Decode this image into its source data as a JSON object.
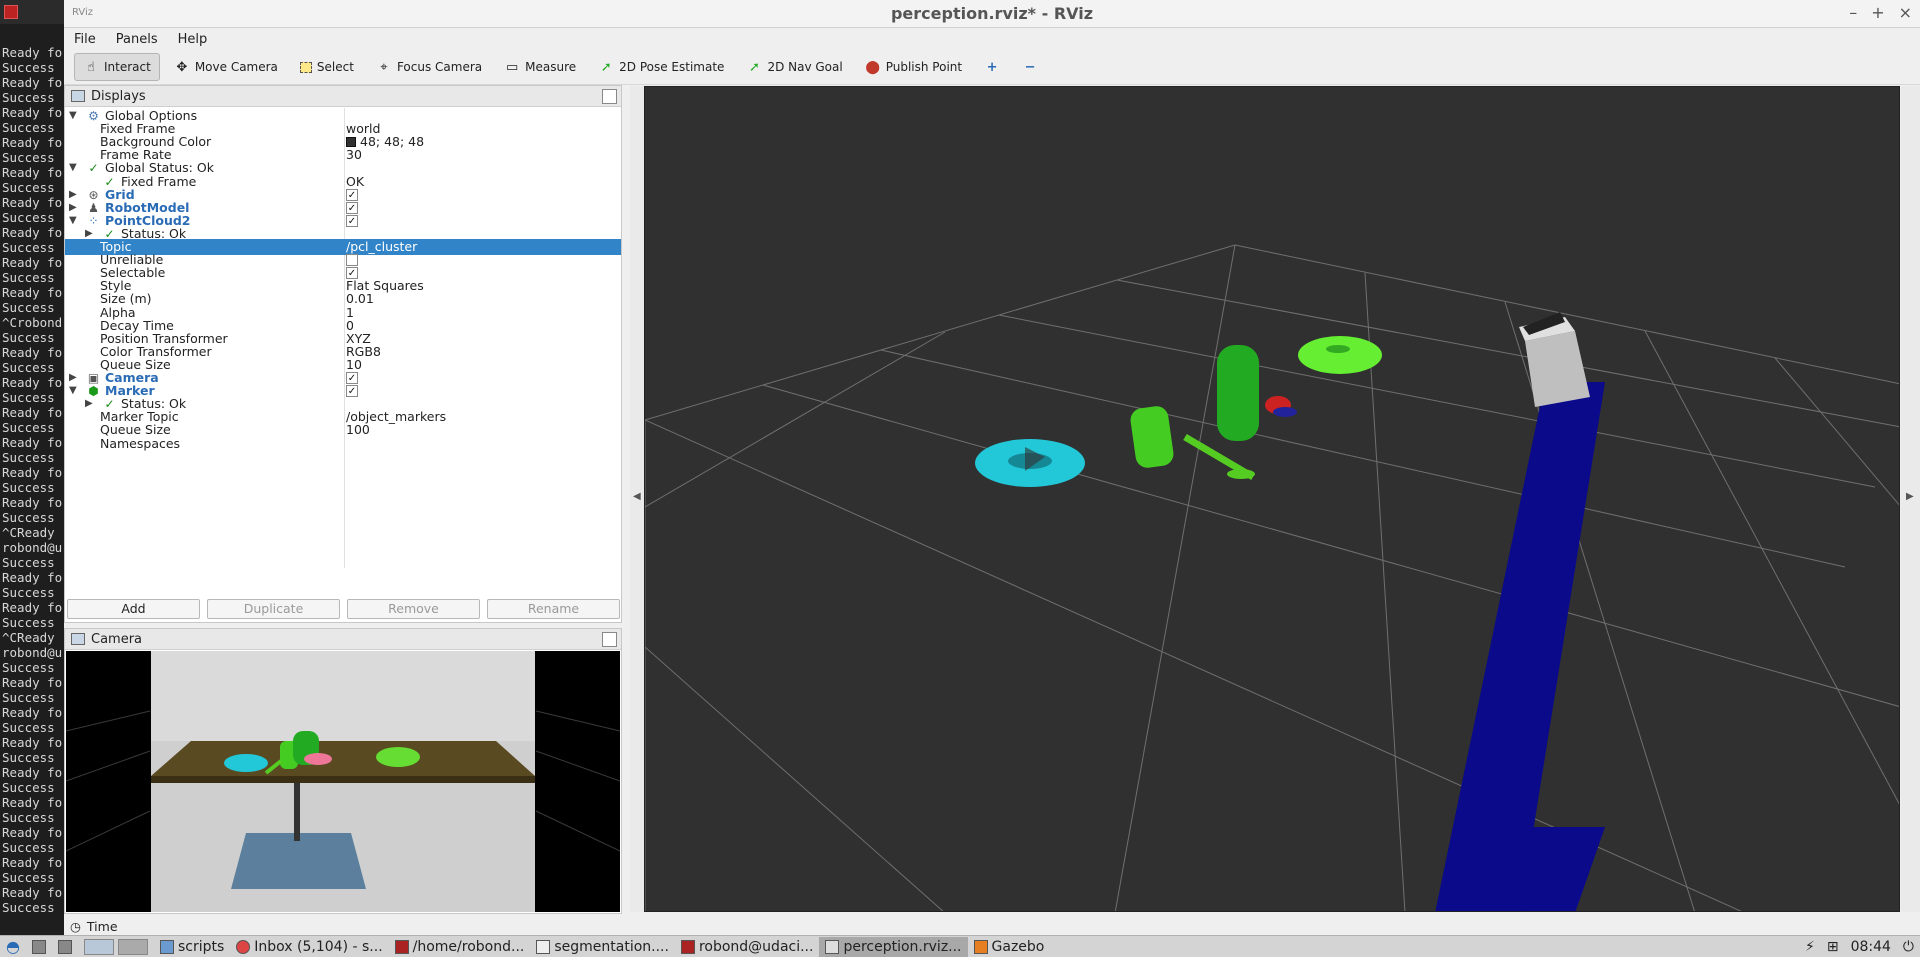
{
  "terminal": {
    "lines": [
      "Ready fo",
      "Success",
      "Ready fo",
      "Success",
      "Ready fo",
      "Success",
      "Ready fo",
      "Success",
      "Ready fo",
      "Success",
      "Ready fo",
      "Success",
      "Ready fo",
      "Success",
      "Ready fo",
      "Success",
      "Ready fo",
      "Success",
      "^Crobond",
      "Success",
      "Ready fo",
      "Success",
      "Ready fo",
      "Success",
      "Ready fo",
      "Success",
      "Ready fo",
      "Success",
      "Ready fo",
      "Success",
      "Ready fo",
      "Success",
      "^CReady",
      "robond@u",
      "Success",
      "Ready fo",
      "Success",
      "Ready fo",
      "Success",
      "^CReady",
      "robond@u",
      "Success",
      "Ready fo",
      "Success",
      "Ready fo",
      "Success",
      "Ready fo",
      "Success",
      "Ready fo",
      "Success",
      "Ready fo",
      "Success",
      "Ready fo",
      "Success",
      "Ready fo",
      "Success",
      "Ready fo",
      "Success"
    ]
  },
  "window": {
    "title": "perception.rviz* - RViz",
    "app_icon": "RViz"
  },
  "menu": {
    "file": "File",
    "panels": "Panels",
    "help": "Help"
  },
  "toolbar": {
    "interact": "Interact",
    "move_camera": "Move Camera",
    "select": "Select",
    "focus_camera": "Focus Camera",
    "measure": "Measure",
    "pose_estimate": "2D Pose Estimate",
    "nav_goal": "2D Nav Goal",
    "publish_point": "Publish Point"
  },
  "displays": {
    "title": "Displays",
    "rows": [
      {
        "label": "Global Options",
        "value": ""
      },
      {
        "label": "Fixed Frame",
        "value": "world"
      },
      {
        "label": "Background Color",
        "value": "48; 48; 48"
      },
      {
        "label": "Frame Rate",
        "value": "30"
      },
      {
        "label": "Global Status: Ok",
        "value": ""
      },
      {
        "label": "Fixed Frame",
        "value": "OK"
      },
      {
        "label": "Grid",
        "value": ""
      },
      {
        "label": "RobotModel",
        "value": ""
      },
      {
        "label": "PointCloud2",
        "value": ""
      },
      {
        "label": "Status: Ok",
        "value": ""
      },
      {
        "label": "Topic",
        "value": "/pcl_cluster"
      },
      {
        "label": "Unreliable",
        "value": ""
      },
      {
        "label": "Selectable",
        "value": ""
      },
      {
        "label": "Style",
        "value": "Flat Squares"
      },
      {
        "label": "Size (m)",
        "value": "0.01"
      },
      {
        "label": "Alpha",
        "value": "1"
      },
      {
        "label": "Decay Time",
        "value": "0"
      },
      {
        "label": "Position Transformer",
        "value": "XYZ"
      },
      {
        "label": "Color Transformer",
        "value": "RGB8"
      },
      {
        "label": "Queue Size",
        "value": "10"
      },
      {
        "label": "Camera",
        "value": ""
      },
      {
        "label": "Marker",
        "value": ""
      },
      {
        "label": "Status: Ok",
        "value": ""
      },
      {
        "label": "Marker Topic",
        "value": "/object_markers"
      },
      {
        "label": "Queue Size",
        "value": "100"
      },
      {
        "label": "Namespaces",
        "value": ""
      }
    ],
    "checked": {
      "grid": true,
      "robotmodel": true,
      "pointcloud2": true,
      "unreliable": false,
      "selectable": true,
      "camera": true,
      "marker": true
    },
    "buttons": {
      "add": "Add",
      "duplicate": "Duplicate",
      "remove": "Remove",
      "rename": "Rename"
    }
  },
  "camera_panel": {
    "title": "Camera"
  },
  "time_panel": {
    "title": "Time"
  },
  "colors": {
    "background": "#303030",
    "selection": "#3284c8",
    "pointcloud_cyan": "#22c8d8",
    "pointcloud_green": "#44cc22",
    "robot_blue": "#0a0a8a"
  },
  "taskbar": {
    "items": [
      "scripts",
      "Inbox (5,104) - s...",
      "/home/robond...",
      "segmentation....",
      "robond@udaci...",
      "perception.rviz...",
      "Gazebo"
    ],
    "clock": "08:44"
  }
}
